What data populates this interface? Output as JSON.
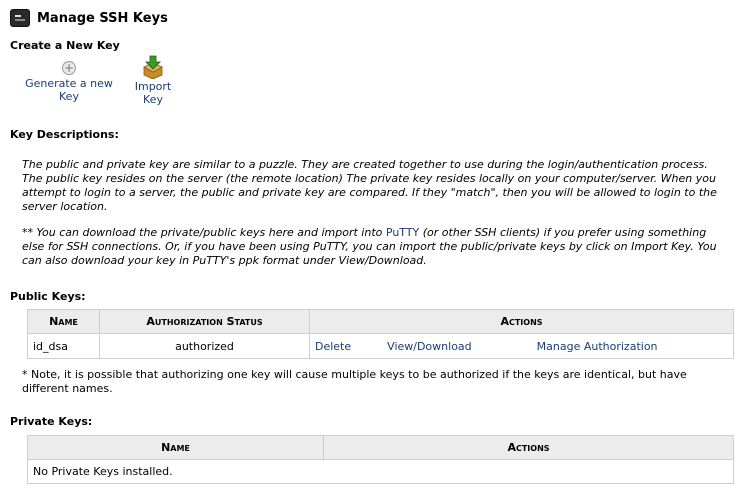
{
  "header": {
    "title": "Manage SSH Keys",
    "icon": "terminal-icon"
  },
  "create": {
    "title": "Create a New Key",
    "generate_label": "Generate a new Key",
    "generate_icon": "plus-circle-icon",
    "import_label": "Import Key",
    "import_icon": "import-arrow-icon"
  },
  "descriptions": {
    "title": "Key Descriptions:",
    "paragraph1": "The public and private key are similar to a puzzle. They are created together to use during the login/authentication process. The public key resides on the server (the remote location) The private key resides locally on your computer/server. When you attempt to login to a server, the public and private key are compared. If they \"match\", then you will be allowed to login to the server location.",
    "paragraph2_pre": "** You can download the private/public keys here and import into ",
    "putty_link": "PuTTY",
    "paragraph2_post": " (or other SSH clients) if you prefer using something else for SSH connections. Or, if you have been using PuTTY, you can import the public/private keys by click on Import Key. You can also download your key in PuTTY's ppk format under View/Download."
  },
  "public_keys": {
    "title": "Public Keys:",
    "columns": {
      "name": "Name",
      "status": "Authorization Status",
      "actions": "Actions"
    },
    "rows": [
      {
        "name": "id_dsa",
        "status": "authorized",
        "delete": "Delete",
        "view": "View/Download",
        "manage": "Manage Authorization"
      }
    ],
    "note": "* Note, it is possible that authorizing one key will cause multiple keys to be authorized if the keys are identical, but have different names."
  },
  "private_keys": {
    "title": "Private Keys:",
    "columns": {
      "name": "Name",
      "actions": "Actions"
    },
    "empty_message": "No Private Keys installed."
  }
}
